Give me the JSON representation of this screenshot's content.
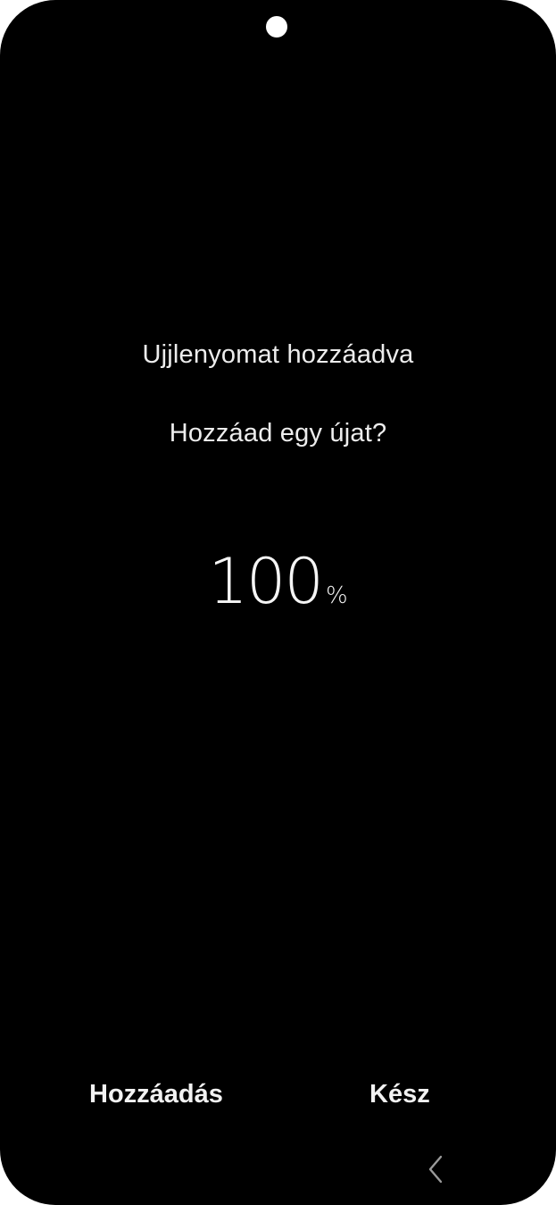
{
  "screen": {
    "title": "Ujjlenyomat hozzáadva",
    "subtitle": "Hozzáad egy újat?",
    "progress": {
      "value": "100",
      "unit": "%"
    }
  },
  "actions": {
    "add_label": "Hozzáadás",
    "done_label": "Kész"
  },
  "nav": {
    "back_icon": "chevron-left-icon"
  },
  "colors": {
    "background": "#000000",
    "text": "#ededed"
  }
}
